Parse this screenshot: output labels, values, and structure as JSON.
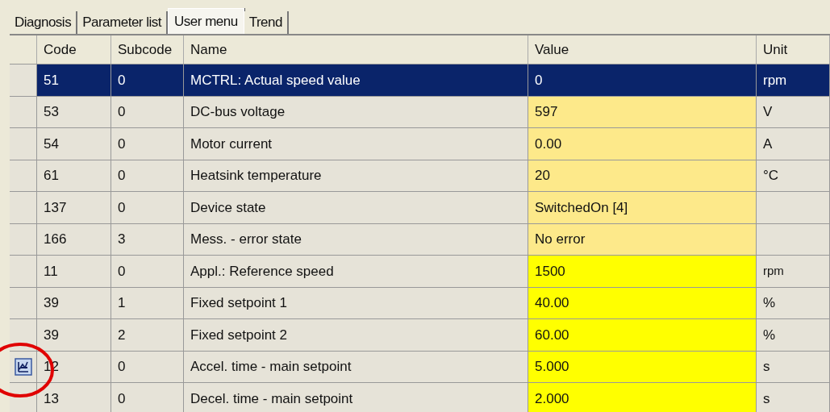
{
  "tabs": [
    {
      "label": "Diagnosis",
      "selected": false
    },
    {
      "label": "Parameter list",
      "selected": false
    },
    {
      "label": "User menu",
      "selected": true
    },
    {
      "label": "Trend",
      "selected": false
    }
  ],
  "table": {
    "columns": [
      "Code",
      "Subcode",
      "Name",
      "Value",
      "Unit"
    ],
    "rows": [
      {
        "code": "51",
        "subcode": "0",
        "name": "MCTRL: Actual speed value",
        "value": "0",
        "unit": "rpm",
        "selected": true,
        "marker": false
      },
      {
        "code": "53",
        "subcode": "0",
        "name": "DC-bus voltage",
        "value": "597",
        "unit": "V",
        "kind": "monitor",
        "selected": false,
        "marker": false
      },
      {
        "code": "54",
        "subcode": "0",
        "name": "Motor current",
        "value": "0.00",
        "unit": "A",
        "kind": "monitor",
        "selected": false,
        "marker": false
      },
      {
        "code": "61",
        "subcode": "0",
        "name": "Heatsink temperature",
        "value": "20",
        "unit": "°C",
        "kind": "monitor",
        "selected": false,
        "marker": false
      },
      {
        "code": "137",
        "subcode": "0",
        "name": "Device state",
        "value": "SwitchedOn [4]",
        "unit": "",
        "kind": "monitor",
        "selected": false,
        "marker": false
      },
      {
        "code": "166",
        "subcode": "3",
        "name": "Mess. - error state",
        "value": "No error",
        "unit": "",
        "kind": "monitor",
        "selected": false,
        "marker": false
      },
      {
        "code": "11",
        "subcode": "0",
        "name": "Appl.: Reference speed",
        "value": "1500",
        "unit": "rpm",
        "kind": "parameter",
        "selected": false,
        "marker": false
      },
      {
        "code": "39",
        "subcode": "1",
        "name": "Fixed setpoint 1",
        "value": "40.00",
        "unit": "%",
        "kind": "parameter",
        "selected": false,
        "marker": false
      },
      {
        "code": "39",
        "subcode": "2",
        "name": "Fixed setpoint 2",
        "value": "60.00",
        "unit": "%",
        "kind": "parameter",
        "selected": false,
        "marker": false
      },
      {
        "code": "12",
        "subcode": "0",
        "name": "Accel. time - main setpoint",
        "value": "5.000",
        "unit": "s",
        "kind": "parameter",
        "selected": false,
        "marker": true
      },
      {
        "code": "13",
        "subcode": "0",
        "name": "Decel. time - main setpoint",
        "value": "2.000",
        "unit": "s",
        "kind": "parameter",
        "selected": false,
        "marker": false
      }
    ]
  }
}
